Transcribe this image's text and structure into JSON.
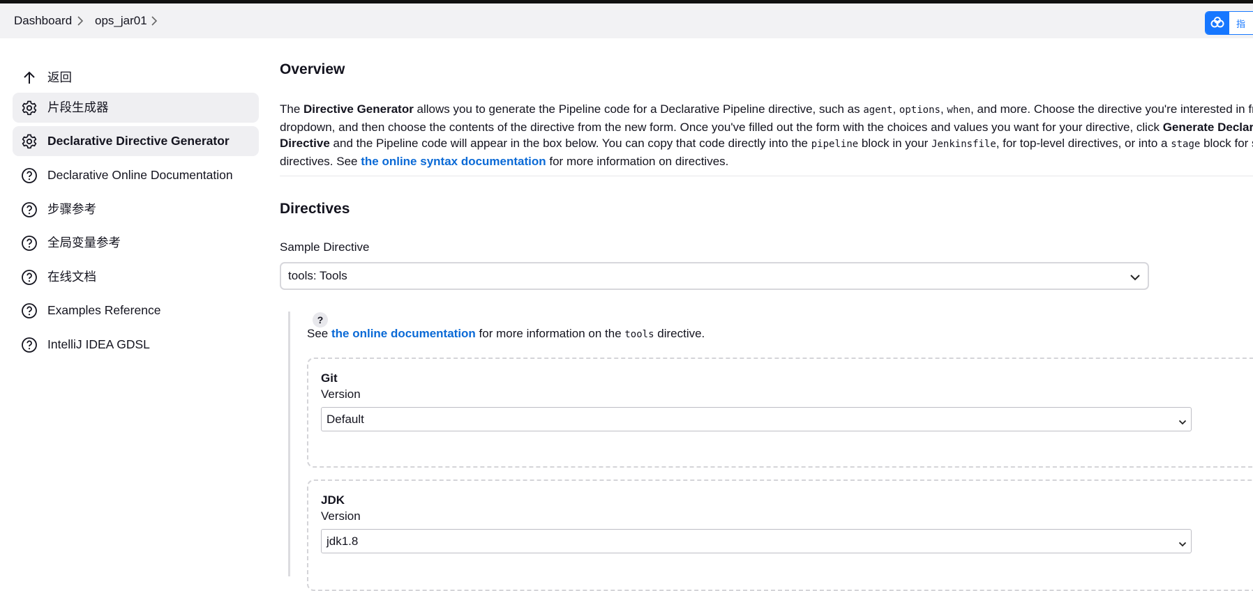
{
  "breadcrumb": {
    "items": [
      "Dashboard",
      "ops_jar01"
    ]
  },
  "corner_widget": {
    "text": "指"
  },
  "sidebar": {
    "items": [
      {
        "label": "返回",
        "icon": "arrow-up-icon"
      },
      {
        "label": "片段生成器",
        "icon": "gear-icon"
      },
      {
        "label": "Declarative Directive Generator",
        "icon": "gear-icon"
      },
      {
        "label": "Declarative Online Documentation",
        "icon": "help-circle-icon"
      },
      {
        "label": "步骤参考",
        "icon": "help-circle-icon"
      },
      {
        "label": "全局变量参考",
        "icon": "help-circle-icon"
      },
      {
        "label": "在线文档",
        "icon": "help-circle-icon"
      },
      {
        "label": "Examples Reference",
        "icon": "help-circle-icon"
      },
      {
        "label": "IntelliJ IDEA GDSL",
        "icon": "help-circle-icon"
      }
    ]
  },
  "overview": {
    "title": "Overview",
    "p1": "The ",
    "b1": "Directive Generator",
    "p2": " allows you to generate the Pipeline code for a Declarative Pipeline directive, such as ",
    "c_agent": "agent",
    "sep1": ", ",
    "c_options": "options",
    "sep2": ", ",
    "c_when": "when",
    "p3": ", and more. Choose the directive you're interested in from the",
    "p4": "dropdown, and then choose the contents of the directive from the new form. Once you've filled out the form with the choices and values you want for your directive, click ",
    "b2": "Generate Declarative",
    "b3": "Directive",
    "p5": " and the Pipeline code will appear in the box below. You can copy that code directly into the ",
    "c_pipeline": "pipeline",
    "p6": " block in your ",
    "c_jenkinsfile": "Jenkinsfile",
    "p7": ", for top-level directives, or into a ",
    "c_stage": "stage",
    "p8": " block for stage",
    "p9": "directives. See ",
    "link": "the online syntax documentation",
    "p10": " for more information on directives."
  },
  "directives": {
    "title": "Directives",
    "sample_label": "Sample Directive",
    "sample_value": "tools: Tools",
    "help": "?",
    "hint_pre": "See ",
    "hint_link": "the online documentation",
    "hint_mid": " for more information on the ",
    "hint_code": "tools",
    "hint_post": " directive."
  },
  "tools": [
    {
      "name": "Git",
      "version_label": "Version",
      "value": "Default"
    },
    {
      "name": "JDK",
      "version_label": "Version",
      "value": "jdk1.8"
    }
  ],
  "colors": {
    "link": "#0b6ad6",
    "accent": "#1677ff",
    "sidebar_highlight": "#efeff2"
  }
}
